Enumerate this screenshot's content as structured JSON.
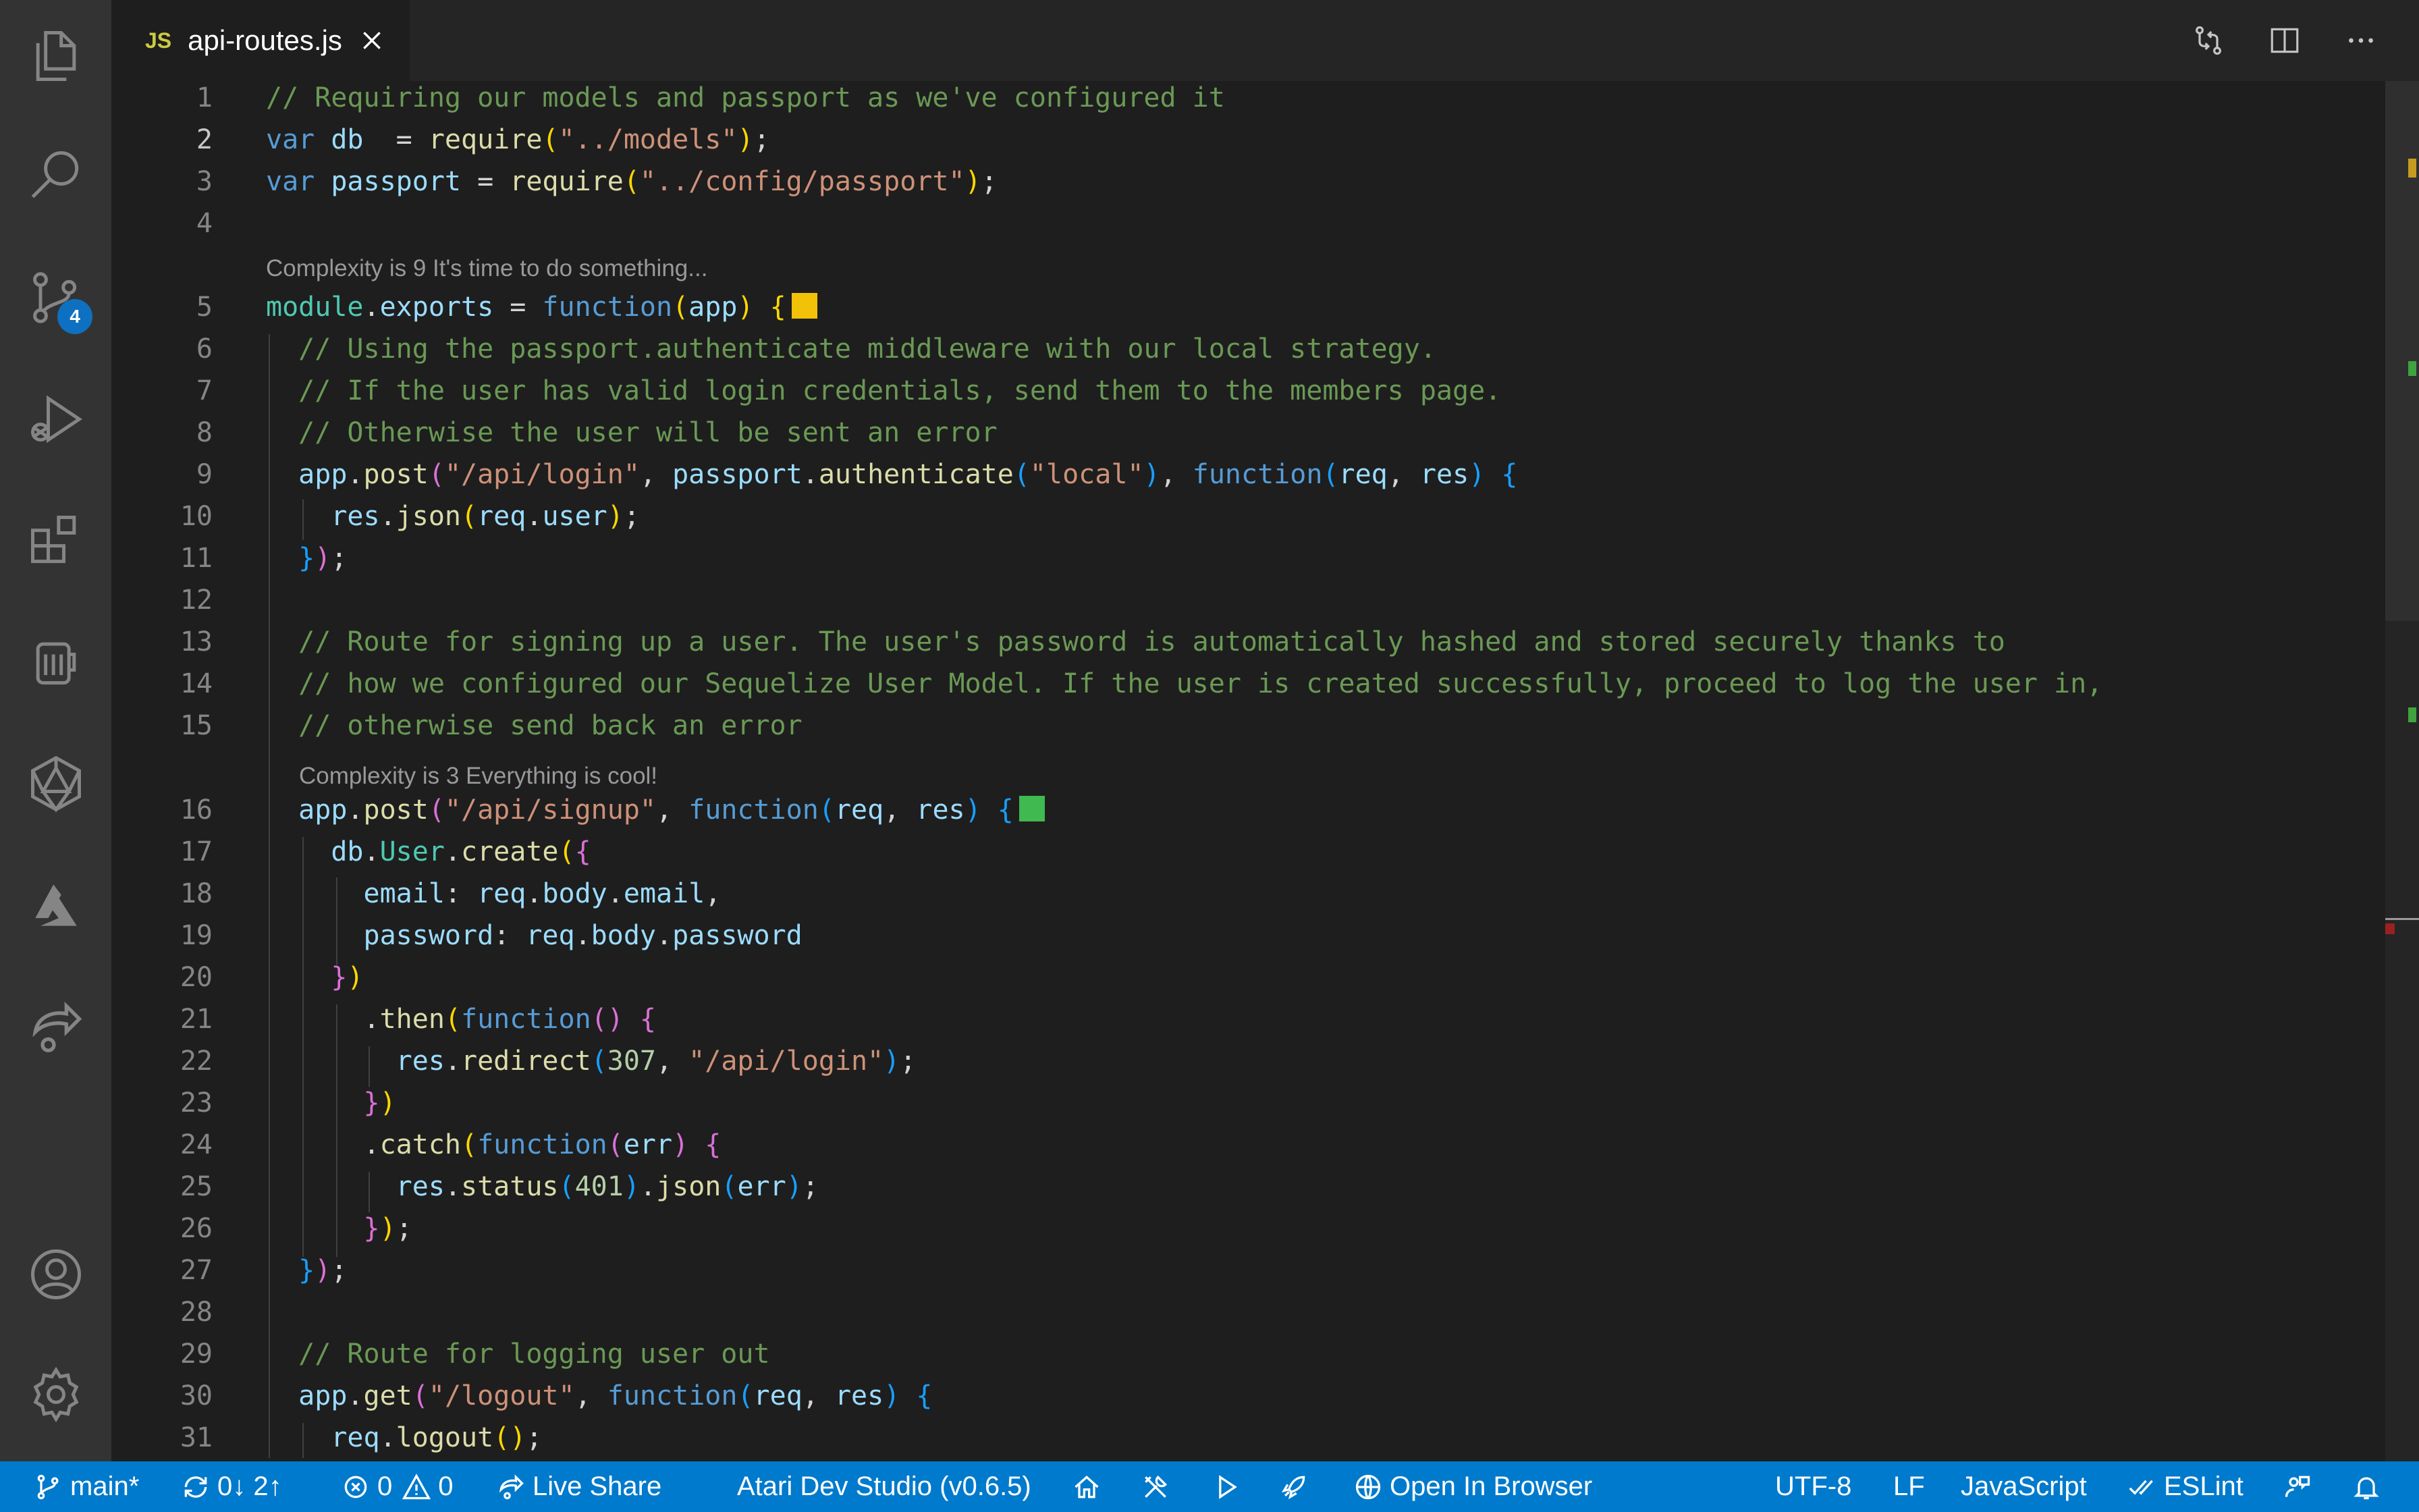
{
  "activity_bar": {
    "source_control_badge": "4"
  },
  "tab": {
    "file_type": "JS",
    "file_name": "api-routes.js"
  },
  "code_lenses": [
    "Complexity is 9 It's time to do something...",
    "Complexity is 3 Everything is cool!"
  ],
  "line_numbers": [
    "1",
    "2",
    "3",
    "4",
    "5",
    "6",
    "7",
    "8",
    "9",
    "10",
    "11",
    "12",
    "13",
    "14",
    "15",
    "16",
    "17",
    "18",
    "19",
    "20",
    "21",
    "22",
    "23",
    "24",
    "25",
    "26",
    "27",
    "28",
    "29",
    "30",
    "31"
  ],
  "code_lines": [
    [
      [
        "cm",
        "// Requiring our models and passport as we've configured it"
      ]
    ],
    [
      [
        "kw",
        "var "
      ],
      [
        "vr",
        "db"
      ],
      [
        "",
        "  = "
      ],
      [
        "fn",
        "require"
      ],
      [
        "yb",
        "("
      ],
      [
        "st",
        "\"../models\""
      ],
      [
        "yb",
        ")"
      ],
      [
        "",
        ";"
      ]
    ],
    [
      [
        "kw",
        "var "
      ],
      [
        "vr",
        "passport"
      ],
      [
        "",
        " = "
      ],
      [
        "fn",
        "require"
      ],
      [
        "yb",
        "("
      ],
      [
        "st",
        "\"../config/passport\""
      ],
      [
        "yb",
        ")"
      ],
      [
        "",
        ";"
      ]
    ],
    [],
    [
      [
        "md",
        "module"
      ],
      [
        "",
        ".",
        ""
      ],
      [
        "vr",
        "exports"
      ],
      [
        "",
        " = "
      ],
      [
        "kw",
        "function"
      ],
      [
        "yb",
        "("
      ],
      [
        "vr",
        "app"
      ],
      [
        "yb",
        ")"
      ],
      [
        "",
        " "
      ],
      [
        "yb",
        "{"
      ]
    ],
    [
      [
        "",
        "  "
      ],
      [
        "cm",
        "// Using the passport.authenticate middleware with our local strategy."
      ]
    ],
    [
      [
        "",
        "  "
      ],
      [
        "cm",
        "// If the user has valid login credentials, send them to the members page."
      ]
    ],
    [
      [
        "",
        "  "
      ],
      [
        "cm",
        "// Otherwise the user will be sent an error"
      ]
    ],
    [
      [
        "",
        "  "
      ],
      [
        "vr",
        "app"
      ],
      [
        "",
        "."
      ],
      [
        "fn",
        "post"
      ],
      [
        "pk",
        "("
      ],
      [
        "st",
        "\"/api/login\""
      ],
      [
        "",
        ", "
      ],
      [
        "vr",
        "passport"
      ],
      [
        "",
        "."
      ],
      [
        "fn",
        "authenticate"
      ],
      [
        "bb",
        "("
      ],
      [
        "st",
        "\"local\""
      ],
      [
        "bb",
        ")"
      ],
      [
        "",
        ", "
      ],
      [
        "kw",
        "function"
      ],
      [
        "bb",
        "("
      ],
      [
        "vr",
        "req"
      ],
      [
        "",
        ", "
      ],
      [
        "vr",
        "res"
      ],
      [
        "bb",
        ")"
      ],
      [
        "",
        " "
      ],
      [
        "bb",
        "{"
      ]
    ],
    [
      [
        "",
        "    "
      ],
      [
        "vr",
        "res"
      ],
      [
        "",
        "."
      ],
      [
        "fn",
        "json"
      ],
      [
        "yb",
        "("
      ],
      [
        "vr",
        "req"
      ],
      [
        "",
        "."
      ],
      [
        "vr",
        "user"
      ],
      [
        "yb",
        ")"
      ],
      [
        "",
        ";"
      ]
    ],
    [
      [
        "",
        "  "
      ],
      [
        "bb",
        "}"
      ],
      [
        "pk",
        ")"
      ],
      [
        "",
        ";"
      ]
    ],
    [],
    [
      [
        "",
        "  "
      ],
      [
        "cm",
        "// Route for signing up a user. The user's password is automatically hashed and stored securely thanks to"
      ]
    ],
    [
      [
        "",
        "  "
      ],
      [
        "cm",
        "// how we configured our Sequelize User Model. If the user is created successfully, proceed to log the user in,"
      ]
    ],
    [
      [
        "",
        "  "
      ],
      [
        "cm",
        "// otherwise send back an error"
      ]
    ],
    [
      [
        "",
        "  "
      ],
      [
        "vr",
        "app"
      ],
      [
        "",
        "."
      ],
      [
        "fn",
        "post"
      ],
      [
        "pk",
        "("
      ],
      [
        "st",
        "\"/api/signup\""
      ],
      [
        "",
        ", "
      ],
      [
        "kw",
        "function"
      ],
      [
        "bb",
        "("
      ],
      [
        "vr",
        "req"
      ],
      [
        "",
        ", "
      ],
      [
        "vr",
        "res"
      ],
      [
        "bb",
        ")"
      ],
      [
        "",
        " "
      ],
      [
        "bb",
        "{"
      ]
    ],
    [
      [
        "",
        "    "
      ],
      [
        "vr",
        "db"
      ],
      [
        "",
        "."
      ],
      [
        "md",
        "User"
      ],
      [
        "",
        "."
      ],
      [
        "fn",
        "create"
      ],
      [
        "yb",
        "("
      ],
      [
        "pk",
        "{"
      ]
    ],
    [
      [
        "",
        "      "
      ],
      [
        "vr",
        "email"
      ],
      [
        "",
        ": "
      ],
      [
        "vr",
        "req"
      ],
      [
        "",
        "."
      ],
      [
        "vr",
        "body"
      ],
      [
        "",
        "."
      ],
      [
        "vr",
        "email"
      ],
      [
        "",
        ","
      ]
    ],
    [
      [
        "",
        "      "
      ],
      [
        "vr",
        "password"
      ],
      [
        "",
        ": "
      ],
      [
        "vr",
        "req"
      ],
      [
        "",
        "."
      ],
      [
        "vr",
        "body"
      ],
      [
        "",
        "."
      ],
      [
        "vr",
        "password"
      ]
    ],
    [
      [
        "",
        "    "
      ],
      [
        "pk",
        "}"
      ],
      [
        "yb",
        ")"
      ]
    ],
    [
      [
        "",
        "      ."
      ],
      [
        "fn",
        "then"
      ],
      [
        "yb",
        "("
      ],
      [
        "kw",
        "function"
      ],
      [
        "pk",
        "()"
      ],
      [
        "",
        " "
      ],
      [
        "pk",
        "{"
      ]
    ],
    [
      [
        "",
        "        "
      ],
      [
        "vr",
        "res"
      ],
      [
        "",
        "."
      ],
      [
        "fn",
        "redirect"
      ],
      [
        "bb",
        "("
      ],
      [
        "nu",
        "307"
      ],
      [
        "",
        ", "
      ],
      [
        "st",
        "\"/api/login\""
      ],
      [
        "bb",
        ")"
      ],
      [
        "",
        ";"
      ]
    ],
    [
      [
        "",
        "      "
      ],
      [
        "pk",
        "}"
      ],
      [
        "yb",
        ")"
      ]
    ],
    [
      [
        "",
        "      ."
      ],
      [
        "fn",
        "catch"
      ],
      [
        "yb",
        "("
      ],
      [
        "kw",
        "function"
      ],
      [
        "pk",
        "("
      ],
      [
        "vr",
        "err"
      ],
      [
        "pk",
        ")"
      ],
      [
        "",
        " "
      ],
      [
        "pk",
        "{"
      ]
    ],
    [
      [
        "",
        "        "
      ],
      [
        "vr",
        "res"
      ],
      [
        "",
        "."
      ],
      [
        "fn",
        "status"
      ],
      [
        "bb",
        "("
      ],
      [
        "nu",
        "401"
      ],
      [
        "bb",
        ")"
      ],
      [
        "",
        "."
      ],
      [
        "fn",
        "json"
      ],
      [
        "bb",
        "("
      ],
      [
        "vr",
        "err"
      ],
      [
        "bb",
        ")"
      ],
      [
        "",
        ";"
      ]
    ],
    [
      [
        "",
        "      "
      ],
      [
        "pk",
        "}"
      ],
      [
        "yb",
        ")"
      ],
      [
        "",
        ";"
      ]
    ],
    [
      [
        "",
        "  "
      ],
      [
        "bb",
        "}"
      ],
      [
        "pk",
        ")"
      ],
      [
        "",
        ";"
      ]
    ],
    [],
    [
      [
        "",
        "  "
      ],
      [
        "cm",
        "// Route for logging user out"
      ]
    ],
    [
      [
        "",
        "  "
      ],
      [
        "vr",
        "app"
      ],
      [
        "",
        "."
      ],
      [
        "fn",
        "get"
      ],
      [
        "pk",
        "("
      ],
      [
        "st",
        "\"/logout\""
      ],
      [
        "",
        ", "
      ],
      [
        "kw",
        "function"
      ],
      [
        "bb",
        "("
      ],
      [
        "vr",
        "req"
      ],
      [
        "",
        ", "
      ],
      [
        "vr",
        "res"
      ],
      [
        "bb",
        ")"
      ],
      [
        "",
        " "
      ],
      [
        "bb",
        "{"
      ]
    ],
    [
      [
        "",
        "    "
      ],
      [
        "vr",
        "req"
      ],
      [
        "",
        "."
      ],
      [
        "fn",
        "logout"
      ],
      [
        "yb",
        "()"
      ],
      [
        "",
        ";"
      ]
    ]
  ],
  "status_bar": {
    "branch": "main*",
    "sync": "0↓ 2↑",
    "errors": "0",
    "warnings": "0",
    "live_share": "Live Share",
    "atari": "Atari Dev Studio (v0.6.5)",
    "open_in_browser": "Open In Browser",
    "encoding": "UTF-8",
    "eol": "LF",
    "language": "JavaScript",
    "eslint": "ESLint"
  },
  "colors": {
    "status_bar": "#007acc",
    "complexity_warning": "#f2c208",
    "complexity_ok": "#3fb950"
  }
}
